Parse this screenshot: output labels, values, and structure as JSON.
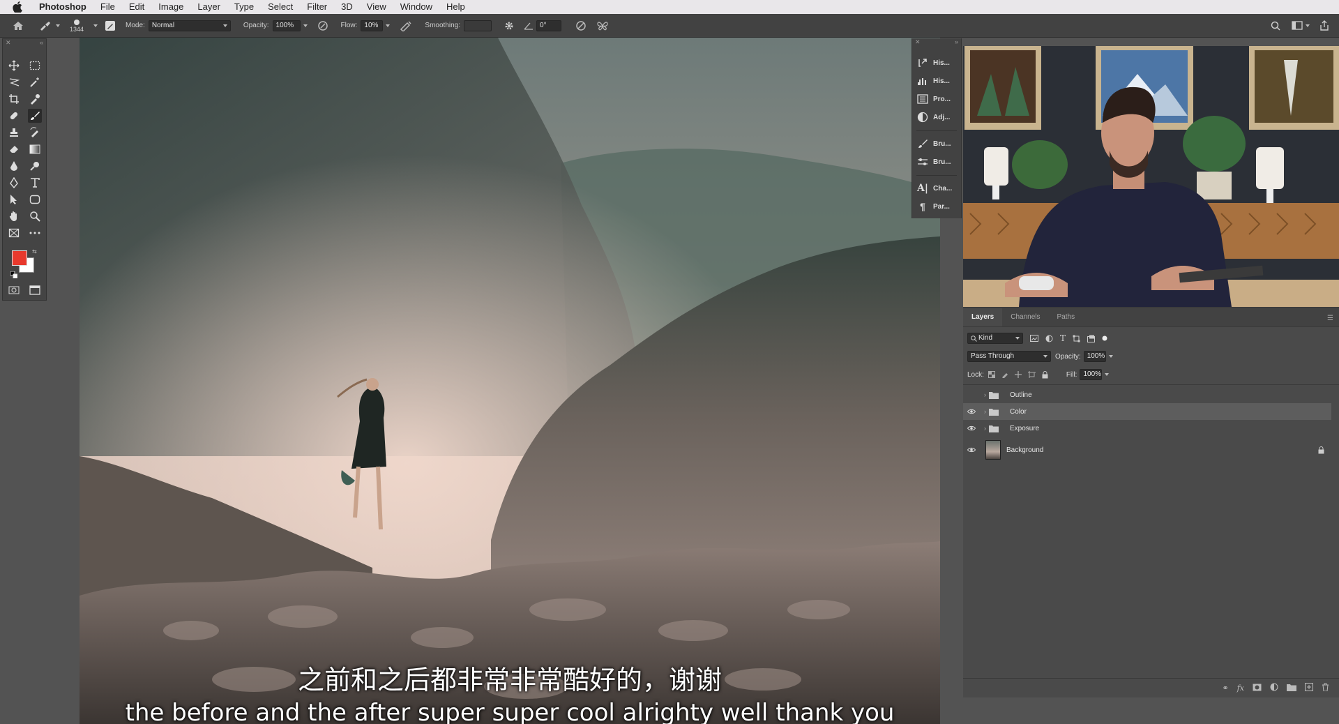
{
  "menubar": {
    "app_name": "Photoshop",
    "items": [
      "File",
      "Edit",
      "Image",
      "Layer",
      "Type",
      "Select",
      "Filter",
      "3D",
      "View",
      "Window",
      "Help"
    ]
  },
  "options_bar": {
    "brush_size": "1344",
    "mode_label": "Mode:",
    "mode_value": "Normal",
    "opacity_label": "Opacity:",
    "opacity_value": "100%",
    "flow_label": "Flow:",
    "flow_value": "10%",
    "smoothing_label": "Smoothing:",
    "smoothing_value": "",
    "angle_value": "0°"
  },
  "toolbox": {
    "foreground_color": "#e8392d",
    "background_color": "#ffffff"
  },
  "dock": {
    "items": [
      {
        "label": "His...",
        "icon": "history-icon"
      },
      {
        "label": "His...",
        "icon": "histogram-icon"
      },
      {
        "label": "Pro...",
        "icon": "properties-icon"
      },
      {
        "label": "Adj...",
        "icon": "adjustments-icon"
      },
      {
        "label": "Bru...",
        "icon": "brush-icon"
      },
      {
        "label": "Bru...",
        "icon": "brush-settings-icon"
      },
      {
        "label": "Cha...",
        "icon": "character-icon"
      },
      {
        "label": "Par...",
        "icon": "paragraph-icon"
      }
    ]
  },
  "layers_panel": {
    "tabs": [
      "Layers",
      "Channels",
      "Paths"
    ],
    "kind_filter": "Kind",
    "blend_mode": "Pass Through",
    "opacity_label": "Opacity:",
    "opacity_value": "100%",
    "lock_label": "Lock:",
    "fill_label": "Fill:",
    "fill_value": "100%",
    "layers": [
      {
        "name": "Outline",
        "type": "group",
        "visible": false,
        "selected": false
      },
      {
        "name": "Color",
        "type": "group",
        "visible": true,
        "selected": true
      },
      {
        "name": "Exposure",
        "type": "group",
        "visible": true,
        "selected": false
      },
      {
        "name": "Background",
        "type": "image",
        "visible": true,
        "selected": false,
        "locked": true
      }
    ]
  },
  "subtitles": {
    "chinese": "之前和之后都非常非常酷好的，谢谢",
    "english": "the before and the after super super cool alrighty well thank you"
  }
}
